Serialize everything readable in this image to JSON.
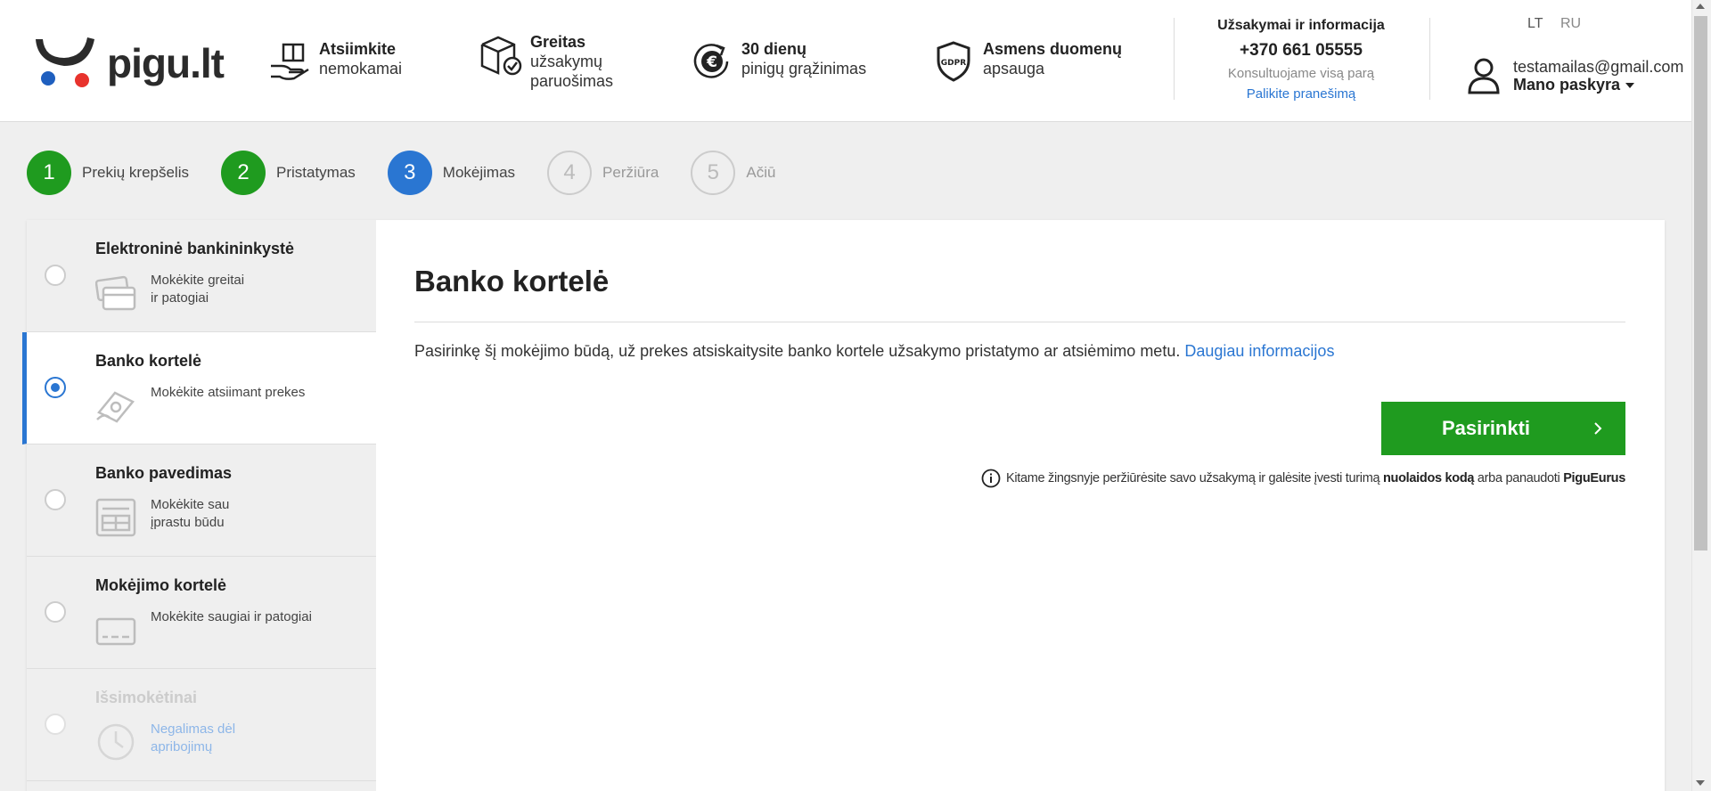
{
  "header": {
    "logo_text": "pigu.lt",
    "features": [
      {
        "icon": "hand-package-icon",
        "bold": "Atsiimkite",
        "lines": [
          "nemokamai"
        ]
      },
      {
        "icon": "box-check-icon",
        "bold": "Greitas",
        "lines": [
          "užsakymų",
          "paruošimas"
        ]
      },
      {
        "icon": "euro-return-icon",
        "bold": "30 dienų",
        "lines": [
          "pinigų grąžinimas"
        ]
      },
      {
        "icon": "gdpr-shield-icon",
        "bold": "Asmens duomenų",
        "lines": [
          "apsauga"
        ]
      }
    ],
    "gdpr_label": "GDPR",
    "contact": {
      "title": "Užsakymai ir informacija",
      "phone": "+370 661 05555",
      "consult": "Konsultuojame visą parą",
      "link": "Palikite pranešimą"
    },
    "languages": [
      "LT",
      "RU"
    ],
    "account": {
      "email": "testamailas@gmail.com",
      "label": "Mano paskyra"
    }
  },
  "steps": [
    {
      "number": "1",
      "label": "Prekių krepšelis",
      "state": "done"
    },
    {
      "number": "2",
      "label": "Pristatymas",
      "state": "done"
    },
    {
      "number": "3",
      "label": "Mokėjimas",
      "state": "active"
    },
    {
      "number": "4",
      "label": "Peržiūra",
      "state": "todo"
    },
    {
      "number": "5",
      "label": "Ačiū",
      "state": "todo"
    }
  ],
  "payment_methods": [
    {
      "title": "Elektroninė bankininkystė",
      "desc": [
        "Mokėkite greitai",
        "ir patogiai"
      ],
      "icon": "cards-icon",
      "selected": false,
      "disabled": false
    },
    {
      "title": "Banko kortelė",
      "desc": [
        "Mokėkite atsiimant prekes"
      ],
      "icon": "cash-hand-icon",
      "selected": true,
      "disabled": false
    },
    {
      "title": "Banko pavedimas",
      "desc": [
        "Mokėkite sau",
        "įprastu būdu"
      ],
      "icon": "transfer-form-icon",
      "selected": false,
      "disabled": false
    },
    {
      "title": "Mokėjimo kortelė",
      "desc": [
        "Mokėkite saugiai ir patogiai"
      ],
      "icon": "payment-card-icon",
      "selected": false,
      "disabled": false
    },
    {
      "title": "Išsimokėtinai",
      "desc": [
        "Negalimas dėl",
        "apribojimų"
      ],
      "icon": "clock-icon",
      "selected": false,
      "disabled": true
    }
  ],
  "details": {
    "title": "Banko kortelė",
    "description": "Pasirinkę šį mokėjimo būdą, už prekes atsiskaitysite banko kortele užsakymo pristatymo ar atsiėmimo metu.",
    "more_link": "Daugiau informacijos",
    "button_label": "Pasirinkti",
    "info_prefix": "Kitame žingsnyje peržiūrėsite savo užsakymą ir galėsite įvesti turimą",
    "info_bold1": "nuolaidos kodą",
    "info_mid": "arba panaudoti",
    "info_bold2": "PiguEurus"
  },
  "colors": {
    "green": "#1f9b1f",
    "blue": "#2a76d2",
    "logo_red": "#e8332d",
    "logo_blue": "#1f5fbf"
  }
}
